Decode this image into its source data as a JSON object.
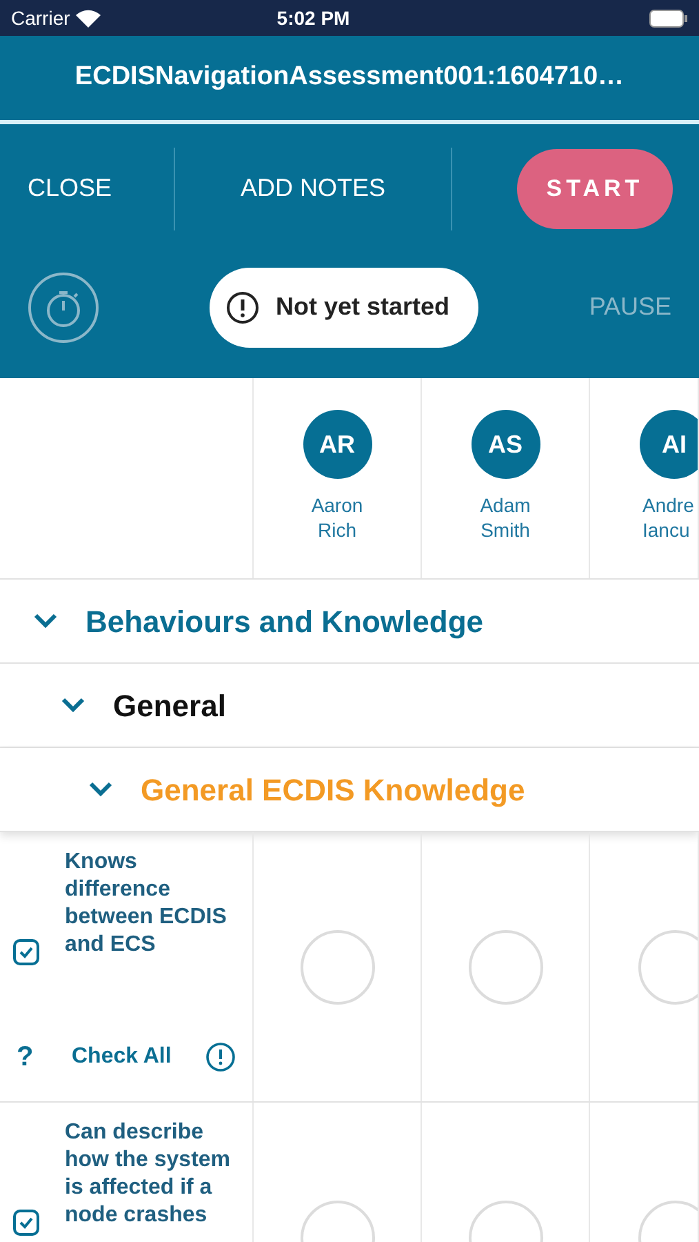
{
  "status_bar": {
    "carrier": "Carrier",
    "time": "5:02 PM"
  },
  "title": "ECDISNavigationAssessment001:1604710…",
  "toolbar": {
    "close": "CLOSE",
    "add_notes": "ADD NOTES",
    "start": "START",
    "status": "Not yet started",
    "pause": "PAUSE"
  },
  "students": [
    {
      "initials": "AR",
      "first": "Aaron",
      "last": "Rich"
    },
    {
      "initials": "AS",
      "first": "Adam",
      "last": "Smith"
    },
    {
      "initials": "AI",
      "first": "Andre",
      "last": "Iancu"
    }
  ],
  "sections": [
    {
      "label": "Behaviours and Knowledge",
      "expanded": true
    },
    {
      "label": "General",
      "expanded": true
    },
    {
      "label": "General ECDIS Knowledge",
      "expanded": true
    }
  ],
  "criteria": [
    {
      "text": "Knows difference between ECDIS and ECS",
      "checked": true,
      "help": "?",
      "check_all": "Check All"
    },
    {
      "text": "Can describe how the system is affected if a node crashes",
      "checked": true
    }
  ]
}
